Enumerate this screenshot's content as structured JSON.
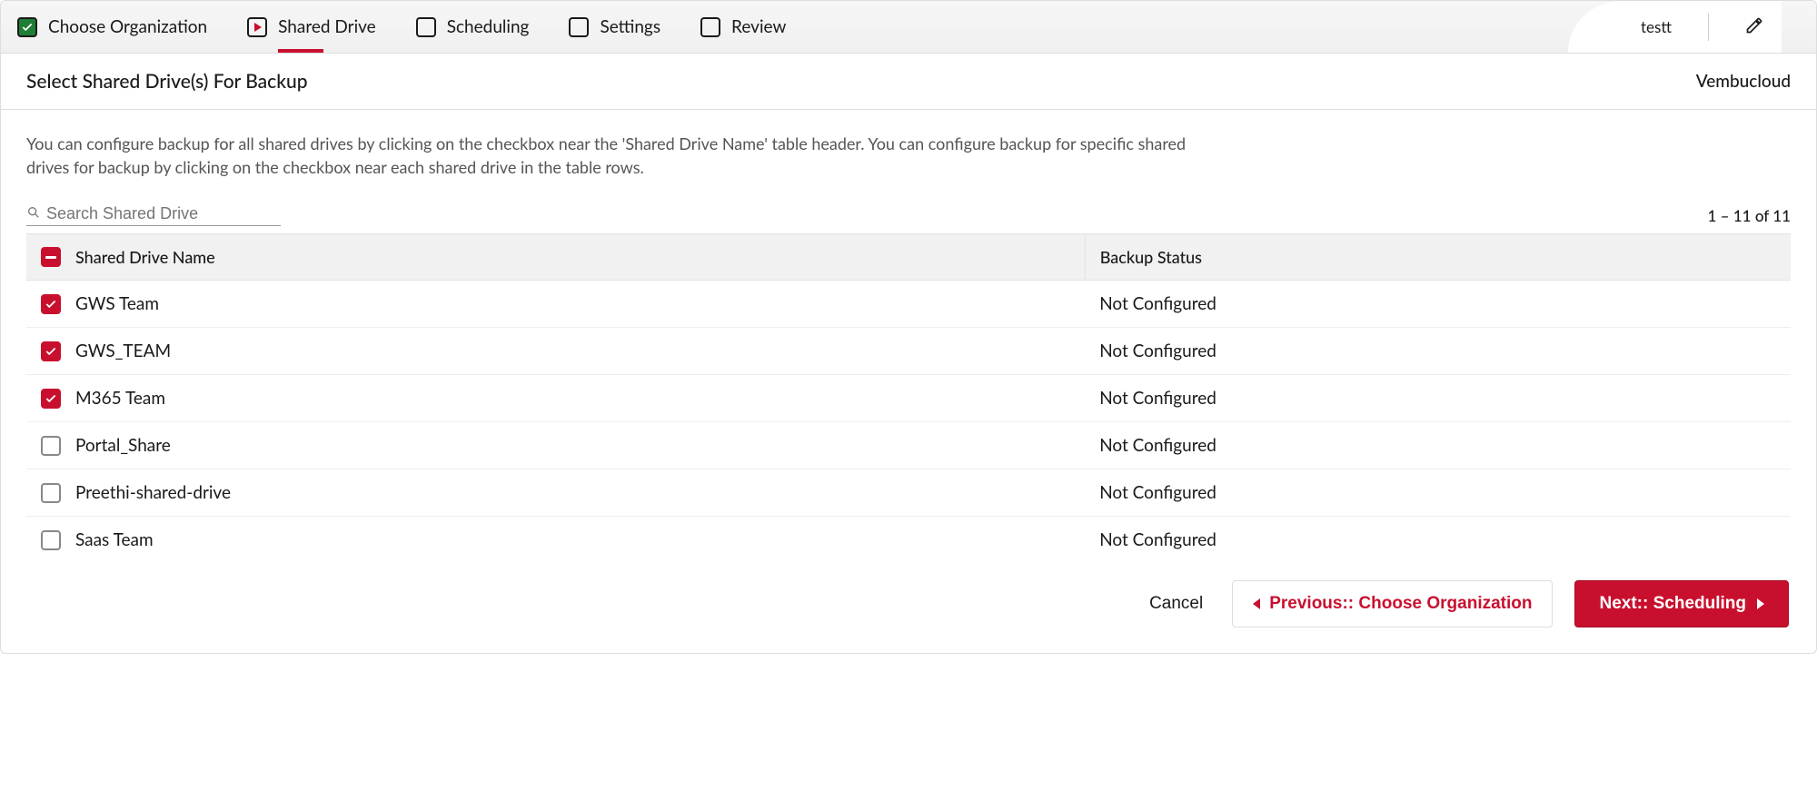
{
  "wizard": {
    "steps": [
      {
        "id": "choose-org",
        "label": "Choose Organization",
        "state": "completed"
      },
      {
        "id": "shared-drive",
        "label": "Shared Drive",
        "state": "current"
      },
      {
        "id": "scheduling",
        "label": "Scheduling",
        "state": "pending"
      },
      {
        "id": "settings",
        "label": "Settings",
        "state": "pending"
      },
      {
        "id": "review",
        "label": "Review",
        "state": "pending"
      }
    ],
    "job_name": "testt"
  },
  "section": {
    "title": "Select Shared Drive(s) For Backup",
    "org": "Vembucloud",
    "help": "You can configure backup for all shared drives by clicking on the checkbox near the 'Shared Drive Name' table header. You can configure backup for specific shared drives for backup by clicking on the checkbox near each shared drive in the table rows."
  },
  "search": {
    "placeholder": "Search Shared Drive"
  },
  "pagination": {
    "range": "1 – 11 of 11"
  },
  "table": {
    "header_state": "indeterminate",
    "columns": {
      "name": "Shared Drive Name",
      "status": "Backup Status"
    },
    "rows": [
      {
        "name": "GWS Team",
        "status": "Not Configured",
        "checked": true
      },
      {
        "name": "GWS_TEAM",
        "status": "Not Configured",
        "checked": true
      },
      {
        "name": "M365 Team",
        "status": "Not Configured",
        "checked": true
      },
      {
        "name": "Portal_Share",
        "status": "Not Configured",
        "checked": false
      },
      {
        "name": "Preethi-shared-drive",
        "status": "Not Configured",
        "checked": false
      },
      {
        "name": "Saas Team",
        "status": "Not Configured",
        "checked": false
      }
    ]
  },
  "footer": {
    "cancel": "Cancel",
    "prev": "Previous:: Choose Organization",
    "next": "Next:: Scheduling"
  }
}
